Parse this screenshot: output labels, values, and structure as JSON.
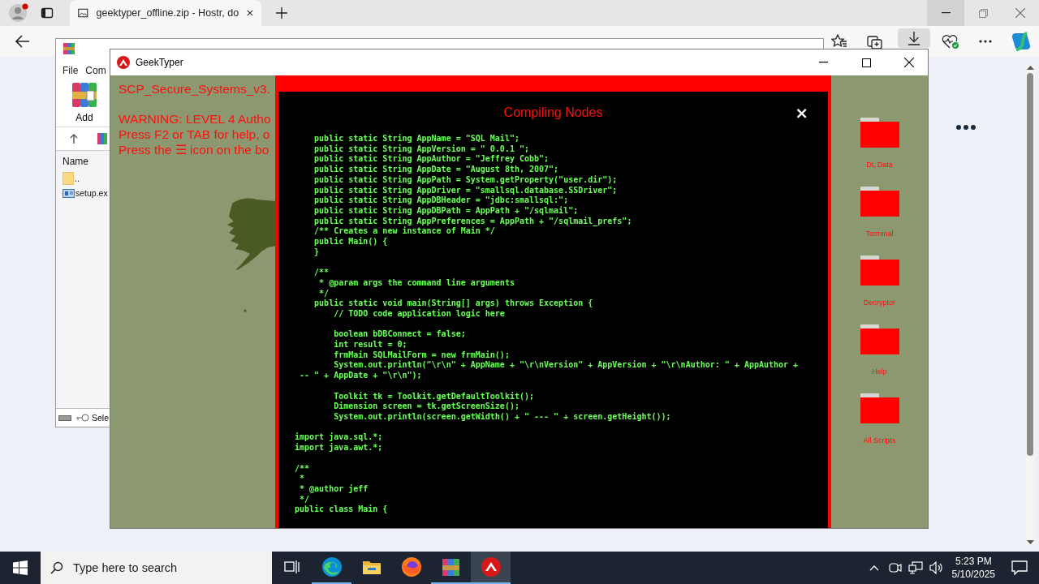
{
  "browser": {
    "tab": {
      "title": "geektyper_offline.zip - Hostr, do",
      "selected": true
    }
  },
  "archiver": {
    "menu": [
      "File",
      "Com"
    ],
    "toolbar": [
      "Add"
    ],
    "columns": [
      "Name"
    ],
    "files": [
      {
        "name": "..",
        "kind": "folder"
      },
      {
        "name": "setup.ex",
        "kind": "exe"
      }
    ],
    "status": "Sele"
  },
  "geektyper": {
    "title": "GeekTyper",
    "heading": "SCP_Secure_Systems_v3.",
    "notices": [
      "WARNING: LEVEL 4 Autho",
      "Press F2 or TAB for help, o",
      "Press the ☰ icon on the bo"
    ]
  },
  "modal": {
    "title": "Compiling Nodes",
    "close": "×",
    "code_blocks": [
      [
        "    public static String AppName = \"SQL Mail\";",
        "    public static String AppVersion = \" 0.0.1 \";",
        "    public static String AppAuthor = \"Jeffrey Cobb\";",
        "    public static String AppDate = \"August 8th, 2007\";",
        "    public static String AppPath = System.getProperty(\"user.dir\");",
        "    public static String AppDriver = \"smallsql.database.SSDriver\";",
        "    public static String AppDBHeader = \"jdbc:smallsql:\";",
        "    public static String AppDBPath = AppPath + \"/sqlmail\";",
        "    public static String AppPreferences = AppPath + \"/sqlmail_prefs\";",
        "    /** Creates a new instance of Main */",
        "    public Main() {",
        "    }"
      ],
      [
        "    /**",
        "     * @param args the command line arguments",
        "     */",
        "    public static void main(String[] args) throws Exception {",
        "        // TODO code application logic here"
      ],
      [
        "        boolean bDBConnect = false;",
        "        int result = 0;",
        "        frmMain SQLMailForm = new frmMain();",
        "        System.out.println(\"\\r\\n\" + AppName + \"\\r\\nVersion\" + AppVersion + \"\\r\\nAuthor: \" + AppAuthor +",
        " -- \" + AppDate + \"\\r\\n\");"
      ],
      [
        "        Toolkit tk = Toolkit.getDefaultToolkit();",
        "        Dimension screen = tk.getScreenSize();",
        "        System.out.println(screen.getWidth() + \" --- \" + screen.getHeight());"
      ],
      [
        "import java.sql.*;",
        "import java.awt.*;"
      ],
      [
        "/**",
        " *",
        " * @author jeff",
        " */",
        "public class Main {"
      ]
    ]
  },
  "folders": [
    {
      "label": "DL Data"
    },
    {
      "label": "Terminal"
    },
    {
      "label": "Decryptor"
    },
    {
      "label": "Help"
    },
    {
      "label": "All Scripts"
    }
  ],
  "taskbar": {
    "search": {
      "placeholder": "Type here to search"
    },
    "apps": [
      {
        "kind": "taskview",
        "running": false,
        "selected": false
      },
      {
        "kind": "edge",
        "running": true,
        "selected": false
      },
      {
        "kind": "files",
        "running": false,
        "selected": false
      },
      {
        "kind": "firefox",
        "running": false,
        "selected": false
      },
      {
        "kind": "archiver",
        "running": true,
        "selected": false
      },
      {
        "kind": "geektyper",
        "running": true,
        "selected": true
      }
    ],
    "time": "5:23 PM",
    "date": "5/10/2025"
  }
}
